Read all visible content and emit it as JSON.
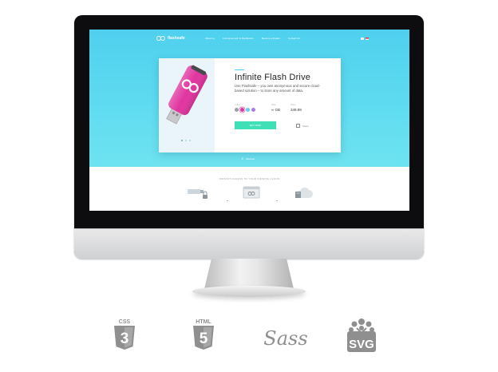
{
  "site": {
    "logo_text": "flashsafe",
    "menu": [
      "About us",
      "Announcement & Distribution",
      "Become a Dealer",
      "Contact Us"
    ]
  },
  "product": {
    "title": "Infinite Flash Drive",
    "description": "Use Flashsafe – you own anonymous and secure cloud-based solution – to store any amount of data.",
    "color_label": "Color",
    "size_label": "Size",
    "price_label": "Price",
    "size_value": "∞ GB",
    "price_value": "349.99",
    "buy_label": "BUY NOW",
    "share_label": "Share",
    "swatch_colors": [
      "#9aa0a6",
      "#d63aa0",
      "#5fd0ee",
      "#a77be0"
    ]
  },
  "hero": {
    "more_label": "Discover"
  },
  "features": {
    "title": "INSTANT ACCESS TO YOUR INFINITE CLOUD"
  },
  "badges": [
    {
      "name": "css3",
      "text": "CSS"
    },
    {
      "name": "html5",
      "text": "HTML"
    },
    {
      "name": "sass",
      "text": "Sass"
    },
    {
      "name": "svg",
      "text": "SVG"
    }
  ],
  "colors": {
    "hero_top": "#4fd0ee",
    "accent_green": "#3fe0b5",
    "drive_pink": "#e0359f",
    "badge_gray": "#8f8f8f"
  }
}
